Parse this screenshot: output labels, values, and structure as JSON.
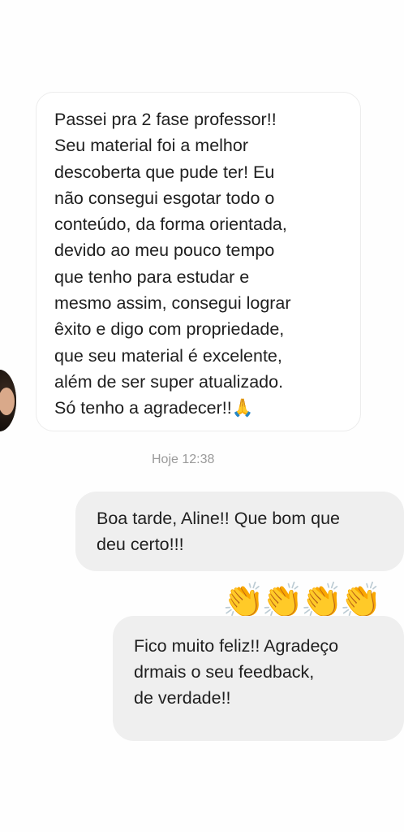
{
  "conversation": {
    "received": {
      "text": "Passei pra 2 fase professor!!\nSeu material foi a melhor\ndescoberta que pude ter! Eu\nnão consegui esgotar todo o\nconteúdo, da forma orientada,\ndevido ao meu pouco tempo\nque tenho para estudar e\nmesmo assim, consegui lograr\nêxito e digo com propriedade,\nque seu material é excelente,\nalém de ser super atualizado.\nSó tenho a agradecer!!🙏"
    },
    "timestamp": "Hoje 12:38",
    "sent": [
      {
        "text": "Boa tarde, Aline!! Que bom que\ndeu certo!!!"
      },
      {
        "text": "👏👏👏👏"
      },
      {
        "text": "Fico muito feliz!! Agradeço\ndrmais o seu feedback,\nde verdade!!"
      }
    ]
  },
  "icons": {
    "avatar": "contact-avatar-photo"
  },
  "colors": {
    "background": "#fefefe",
    "incoming_bubble": "#ffffff",
    "incoming_border": "#ececec",
    "outgoing_bubble": "#efefef",
    "text": "#202020",
    "timestamp": "#9a9a9a"
  }
}
